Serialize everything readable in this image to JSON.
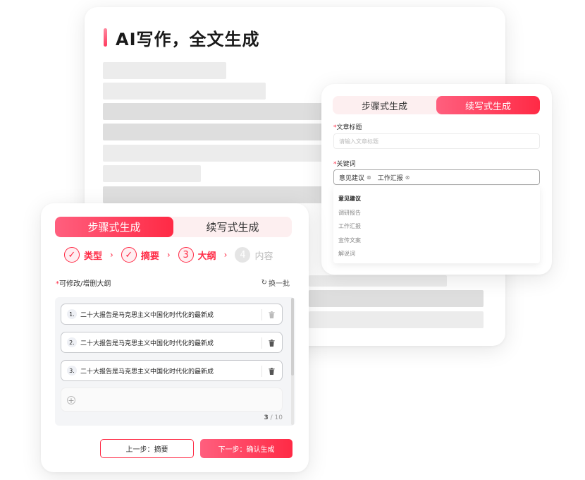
{
  "background_card": {
    "title": "AI写作，全文生成"
  },
  "right_panel": {
    "tabs": [
      {
        "label": "步骤式生成",
        "active": false
      },
      {
        "label": "续写式生成",
        "active": true
      }
    ],
    "title_field": {
      "required_mark": "*",
      "label": "文章标题",
      "placeholder": "请输入文章标题"
    },
    "keywords_field": {
      "required_mark": "*",
      "label": "关键词",
      "tags": [
        "意见建议",
        "工作汇报"
      ],
      "tag_remove_glyph": "⊗"
    },
    "dropdown_options": [
      "意见建议",
      "调研报告",
      "工作汇报",
      "宣传文案",
      "解说词"
    ]
  },
  "front_panel": {
    "tabs": [
      {
        "label": "步骤式生成",
        "active": true
      },
      {
        "label": "续写式生成",
        "active": false
      }
    ],
    "steps": [
      {
        "marker": "✓",
        "label": "类型",
        "state": "done"
      },
      {
        "marker": "✓",
        "label": "摘要",
        "state": "done"
      },
      {
        "marker": "3",
        "label": "大纲",
        "state": "current"
      },
      {
        "marker": "4",
        "label": "内容",
        "state": "pending"
      }
    ],
    "step_arrow": "›",
    "outline_label": {
      "required_mark": "*",
      "text": "可修改/增删大纲"
    },
    "refresh": {
      "icon": "refresh-icon",
      "glyph": "↻",
      "label": "换一批"
    },
    "outline_items": [
      {
        "number": "1.",
        "text": "二十大报告是马克思主义中国化时代化的最新成"
      },
      {
        "number": "2.",
        "text": "二十大报告是马克思主义中国化时代化的最新成"
      },
      {
        "number": "3.",
        "text": "二十大报告是马克思主义中国化时代化的最新成"
      }
    ],
    "add_glyph": "+",
    "counter": {
      "current": "3",
      "total": "/ 10"
    },
    "prev_button": "上一步：摘要",
    "next_button": "下一步：确认生成"
  },
  "colors": {
    "accent": "#ff2a45",
    "accent_light": "#ff5f7e",
    "tab_bg": "#fdeff0",
    "skeleton": "#ececec"
  }
}
